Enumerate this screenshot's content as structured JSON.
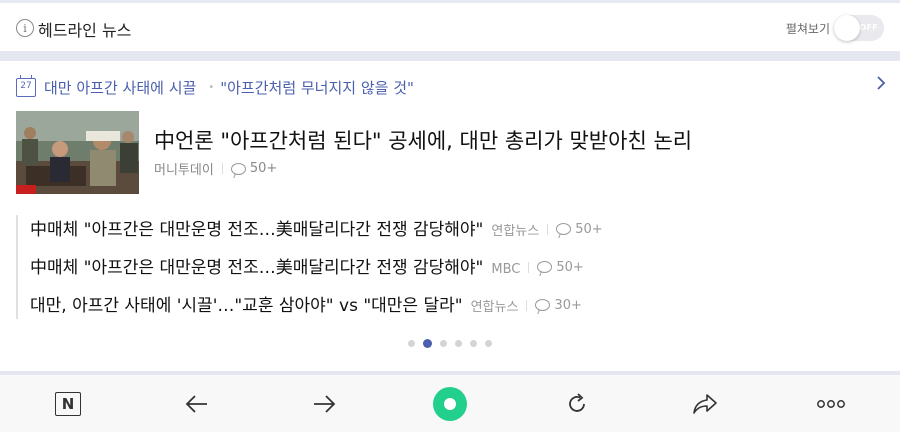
{
  "header": {
    "title": "헤드라인 뉴스",
    "fold_label": "펼쳐보기",
    "toggle_state": "OFF"
  },
  "topic": {
    "calendar_number": "27",
    "main": "대만 아프간 사태에 시끌",
    "sub": "\"아프간처럼 무너지지 않을 것\""
  },
  "lead": {
    "title": "中언론 \"아프간처럼 된다\" 공세에, 대만 총리가 맞받아친 논리",
    "source": "머니투데이",
    "comments": "50+"
  },
  "list": [
    {
      "title": "中매체 \"아프간은 대만운명 전조…美매달리다간 전쟁 감당해야\"",
      "source": "연합뉴스",
      "comments": "50+"
    },
    {
      "title": "中매체 \"아프간은 대만운명 전조…美매달리다간 전쟁 감당해야\"",
      "source": "MBC",
      "comments": "50+"
    },
    {
      "title": "대만, 아프간 사태에 '시끌'…\"교훈 삼아야\" vs \"대만은 달라\"",
      "source": "연합뉴스",
      "comments": "30+"
    }
  ],
  "pagination": {
    "total": 6,
    "active": 2
  },
  "colors": {
    "accent": "#4a5fae",
    "band": "#e4e6f0",
    "green": "#22cf8c"
  },
  "navbar": {
    "n_label": "N"
  }
}
